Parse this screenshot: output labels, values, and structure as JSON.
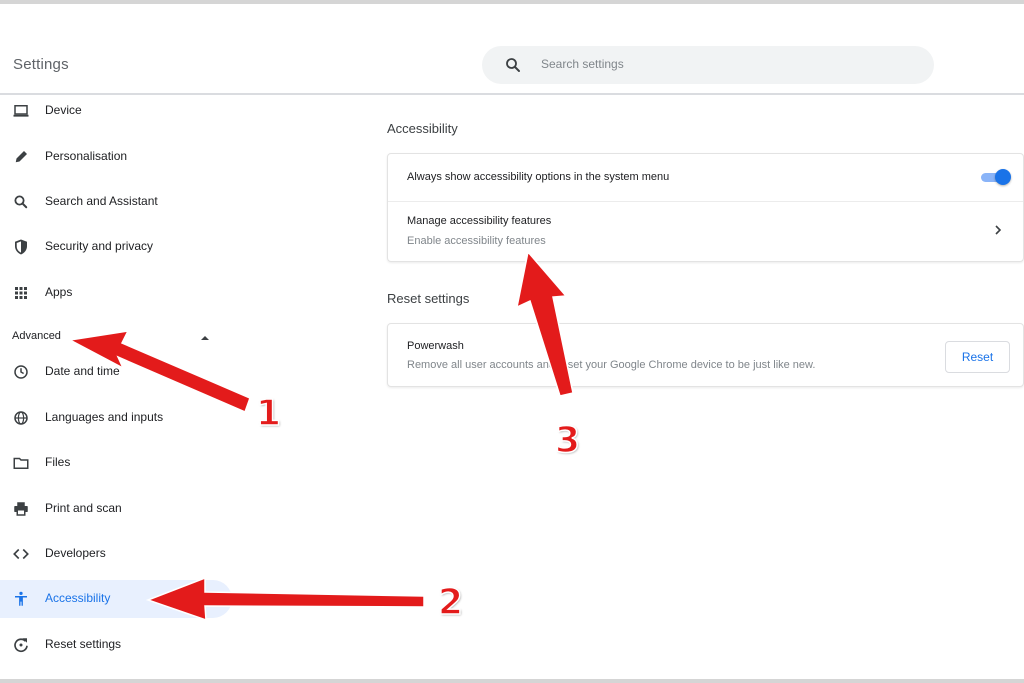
{
  "app": {
    "title": "Settings"
  },
  "search": {
    "placeholder": "Search settings",
    "icon": "search-icon"
  },
  "sidebar": {
    "items": [
      {
        "label": "Device",
        "icon": "laptop-icon"
      },
      {
        "label": "Personalisation",
        "icon": "pencil-icon"
      },
      {
        "label": "Search and Assistant",
        "icon": "search-icon"
      },
      {
        "label": "Security and privacy",
        "icon": "shield-icon"
      },
      {
        "label": "Apps",
        "icon": "apps-grid-icon"
      },
      {
        "label": "Date and time",
        "icon": "clock-icon"
      },
      {
        "label": "Languages and inputs",
        "icon": "globe-icon"
      },
      {
        "label": "Files",
        "icon": "folder-icon"
      },
      {
        "label": "Print and scan",
        "icon": "printer-icon"
      },
      {
        "label": "Developers",
        "icon": "code-icon"
      },
      {
        "label": "Accessibility",
        "icon": "accessibility-icon",
        "active": true
      },
      {
        "label": "Reset settings",
        "icon": "reset-icon"
      }
    ],
    "advanced_label": "Advanced"
  },
  "accessibility": {
    "section_title": "Accessibility",
    "always_show_label": "Always show accessibility options in the system menu",
    "always_show_enabled": true,
    "manage_label": "Manage accessibility features",
    "manage_sub": "Enable accessibility features"
  },
  "reset": {
    "section_title": "Reset settings",
    "powerwash_label": "Powerwash",
    "powerwash_desc": "Remove all user accounts and reset your Google Chrome device to be just like new.",
    "button_label": "Reset"
  },
  "annotations": {
    "color": "#e31b1b",
    "markers": [
      "1",
      "2",
      "3"
    ]
  },
  "colors": {
    "accent": "#1a73e8",
    "active_bg": "#e8f0fe",
    "annotation": "#e31b1b"
  }
}
